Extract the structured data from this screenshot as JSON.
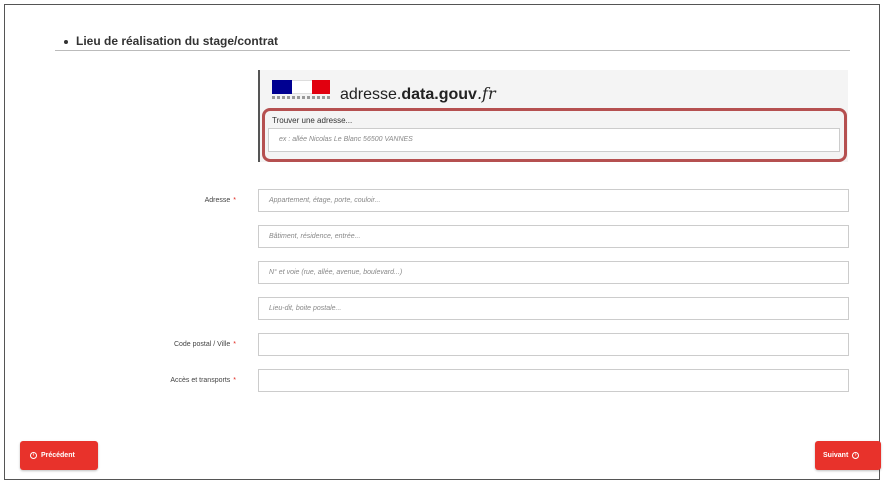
{
  "section": {
    "title": "Lieu de réalisation du stage/contrat"
  },
  "address_widget": {
    "brand_prefix": "adresse.",
    "brand_bold": "data.gouv",
    "brand_suffix": "fr",
    "find_label": "Trouver une adresse...",
    "find_placeholder": "ex : allée Nicolas Le Blanc 56500 VANNES",
    "highlight_color": "#b55050"
  },
  "form": {
    "adresse_label": "Adresse",
    "adresse_line1_placeholder": "Appartement, étage, porte, couloir...",
    "adresse_line2_placeholder": "Bâtiment, résidence, entrée...",
    "adresse_line3_placeholder": "N° et voie (rue, allée, avenue, boulevard...)",
    "adresse_line4_placeholder": "Lieu-dit, boite postale...",
    "code_postal_label": "Code postal / Ville",
    "code_postal_value": "",
    "acces_label": "Accès et transports",
    "acces_value": "",
    "required_marker": "*"
  },
  "nav": {
    "prev_label": "Précédent",
    "next_label": "Suivant",
    "button_color": "#e8322b"
  },
  "icons": {
    "prev": "arrow-left-circle-icon",
    "next": "arrow-right-circle-icon",
    "bullet": "bullet-icon",
    "logo": "marianne-logo"
  }
}
